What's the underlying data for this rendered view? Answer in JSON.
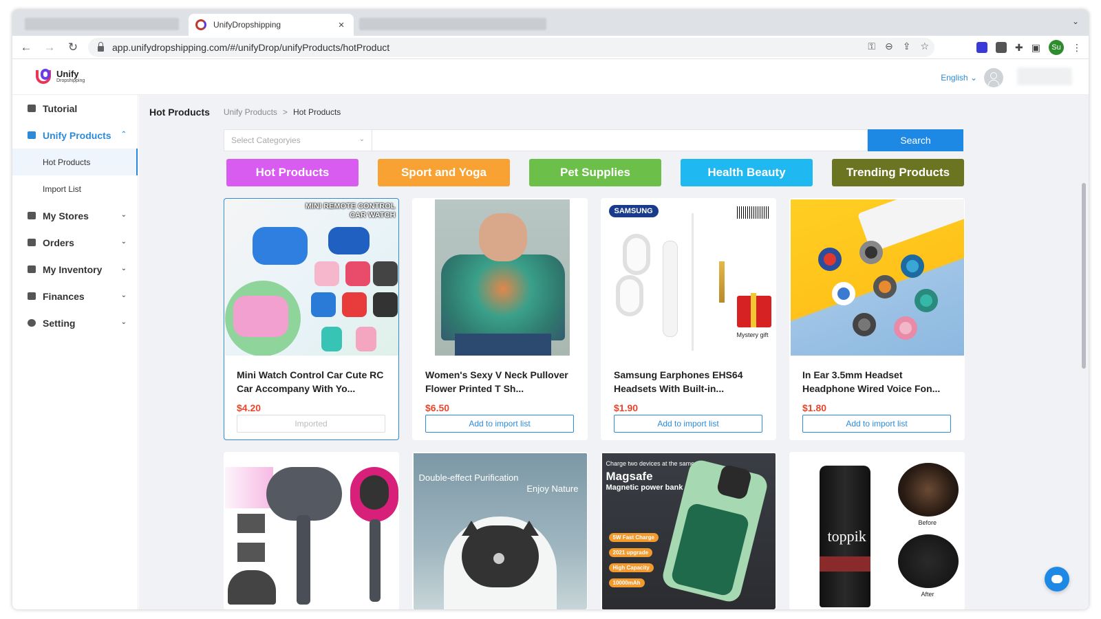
{
  "browser": {
    "tab_title": "UnifyDropshipping",
    "url": "app.unifydropshipping.com/#/unifyDrop/unifyProducts/hotProduct",
    "profile_initials": "Su"
  },
  "header": {
    "logo_name": "Unify",
    "logo_sub": "Dropshipping",
    "language": "English ⌄"
  },
  "sidebar": {
    "items": [
      {
        "label": "Tutorial"
      },
      {
        "label": "Unify Products"
      },
      {
        "label": "My Stores"
      },
      {
        "label": "Orders"
      },
      {
        "label": "My Inventory"
      },
      {
        "label": "Finances"
      },
      {
        "label": "Setting"
      }
    ],
    "subitems": [
      {
        "label": "Hot Products"
      },
      {
        "label": "Import List"
      }
    ]
  },
  "page": {
    "title": "Hot Products",
    "breadcrumb_parent": "Unify Products",
    "breadcrumb_sep": ">",
    "breadcrumb_current": "Hot Products"
  },
  "search": {
    "category_placeholder": "Select Categoryies",
    "button": "Search"
  },
  "categories": [
    {
      "label": "Hot Products",
      "color": "#d85cf0"
    },
    {
      "label": "Sport and Yoga",
      "color": "#f7a232"
    },
    {
      "label": "Pet Supplies",
      "color": "#6cc04a"
    },
    {
      "label": "Health Beauty",
      "color": "#1fb8f0"
    },
    {
      "label": "Trending Products",
      "color": "#6b7420"
    }
  ],
  "products": [
    {
      "name": "Mini Watch Control Car Cute RC Car Accompany With Yo...",
      "price": "$4.20",
      "action": "Imported",
      "thumb_text": "MINI REMOTE CONTROL CAR WATCH"
    },
    {
      "name": "Women's Sexy V Neck Pullover Flower Printed T Sh...",
      "price": "$6.50",
      "action": "Add to import list"
    },
    {
      "name": "Samsung Earphones EHS64 Headsets With Built-in...",
      "price": "$1.90",
      "action": "Add to import list",
      "thumb_text": "SAMSUNG",
      "thumb_text2": "Mystery gift"
    },
    {
      "name": "In Ear 3.5mm Headset Headphone Wired Voice Fon...",
      "price": "$1.80",
      "action": "Add to import list"
    }
  ],
  "products_row2": [
    {
      "thumb": "hair-dryer"
    },
    {
      "thumb": "purifier",
      "thumb_text": "Double-effect Purification",
      "thumb_text2": "Enjoy Nature"
    },
    {
      "thumb": "power-bank",
      "thumb_text": "Charge two devices at the same time",
      "thumb_text2": "Magsafe",
      "thumb_text3": "Magnetic power bank",
      "badges": [
        "5W Fast Charge",
        "2021 upgrade",
        "High Capacity",
        "10000mAh"
      ]
    },
    {
      "thumb": "hair-fiber",
      "thumb_text": "toppik",
      "thumb_text2": "Before",
      "thumb_text3": "After"
    }
  ]
}
